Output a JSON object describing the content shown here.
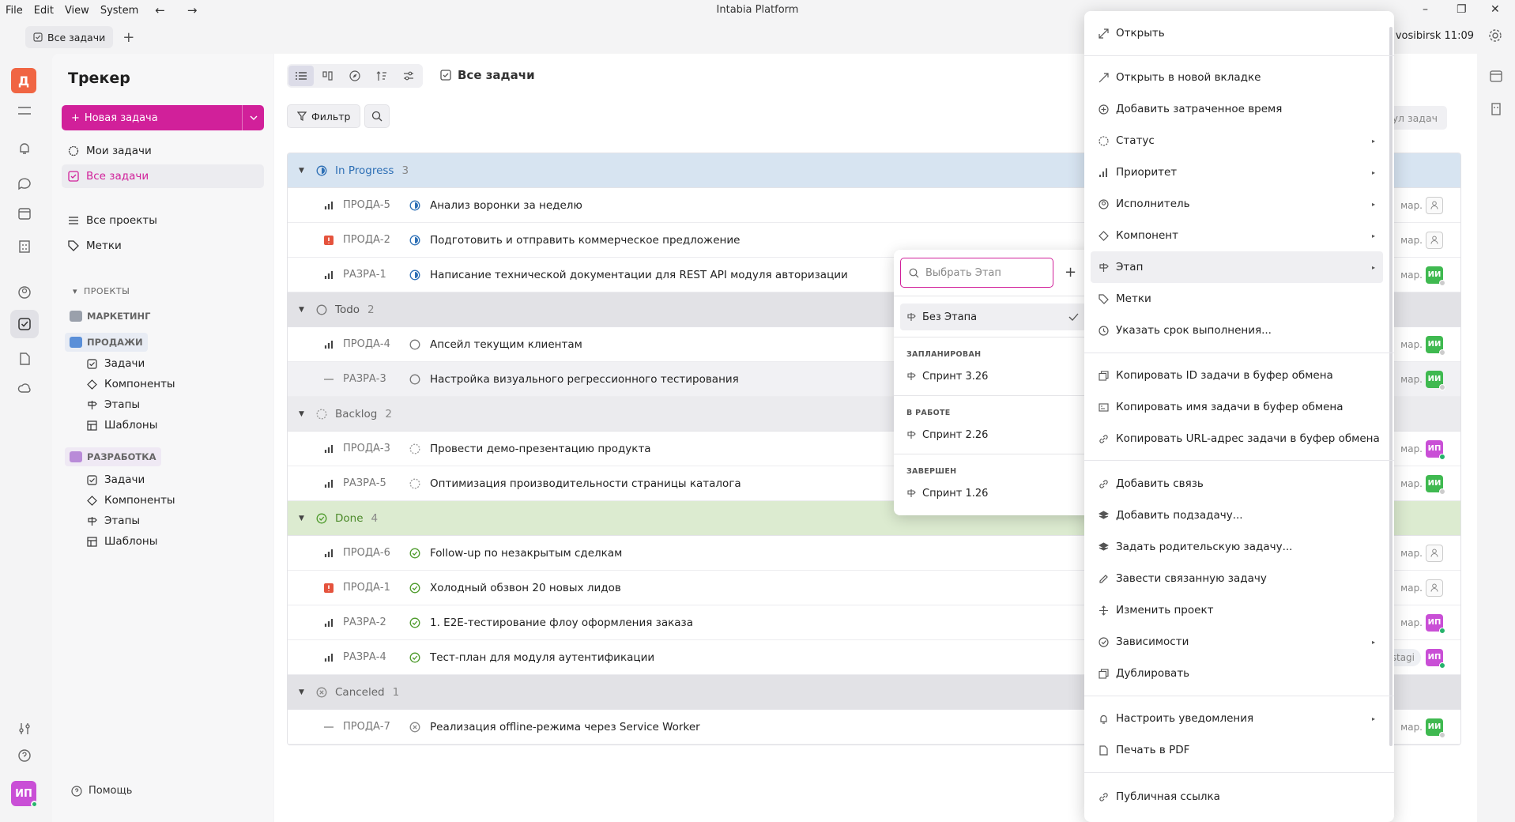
{
  "menubar": {
    "items": [
      "File",
      "Edit",
      "View",
      "System"
    ],
    "back": "←",
    "forward": "→",
    "app_title": "Intabia Platform",
    "win": {
      "min": "–",
      "max": "❐",
      "close": "✕"
    }
  },
  "tabs": [
    {
      "label": "Все задачи"
    }
  ],
  "tab_add": "+",
  "clock": "vosibirsk 11:09",
  "rail": {
    "avatar_top": "Д",
    "avatar_bottom": "ИП"
  },
  "sidebar": {
    "title": "Трекер",
    "new_task": "Новая задача",
    "my_tasks": "Мои задачи",
    "all_tasks": "Все задачи",
    "all_projects": "Все проекты",
    "labels": "Метки",
    "projects_header": "ПРОЕКТЫ",
    "projects": [
      {
        "name": "МАРКЕТИНГ",
        "color": "#9aa0ab"
      },
      {
        "name": "ПРОДАЖИ",
        "color": "#5a8fd8",
        "subs": [
          "Задачи",
          "Компоненты",
          "Этапы",
          "Шаблоны"
        ]
      },
      {
        "name": "РАЗРАБОТКА",
        "color": "#b98bd8",
        "subs": [
          "Задачи",
          "Компоненты",
          "Этапы",
          "Шаблоны"
        ]
      }
    ],
    "help": "Помощь"
  },
  "main": {
    "title": "Все задачи",
    "filter": "Фильтр",
    "pool": "Пул задач",
    "groups": [
      {
        "name": "In Progress",
        "count": "3",
        "bg": "#d7e4f1",
        "color": "#2d6fb5",
        "rows": [
          {
            "id": "ПРОДА-5",
            "name": "Анализ воронки за неделю",
            "pri": "bars",
            "tail": "мар.",
            "asg": "",
            "asg_color": ""
          },
          {
            "id": "ПРОДА-2",
            "name": "Подготовить и отправить коммерческое предложение",
            "pri": "urgent",
            "tail": "мар.",
            "asg": "",
            "asg_color": ""
          },
          {
            "id": "РАЗРА-1",
            "name": "Написание технической документации для REST API модуля авторизации",
            "pri": "bars",
            "tail": "мар.",
            "asg": "ИИ",
            "asg_color": "#3fb950"
          }
        ]
      },
      {
        "name": "Todo",
        "count": "2",
        "bg": "#e2e2e6",
        "color": "#555",
        "rows": [
          {
            "id": "ПРОДА-4",
            "name": "Апсейл текущим клиентам",
            "pri": "bars",
            "tail": "мар.",
            "asg": "ИИ",
            "asg_color": "#3fb950"
          },
          {
            "id": "РАЗРА-3",
            "name": "Настройка визуального регрессионного тестирования",
            "pri": "none",
            "tail": "мар.",
            "asg": "ИИ",
            "asg_color": "#3fb950"
          }
        ]
      },
      {
        "name": "Backlog",
        "count": "2",
        "bg": "#ebebee",
        "color": "#666",
        "rows": [
          {
            "id": "ПРОДА-3",
            "name": "Провести демо-презентацию продукта",
            "pri": "bars",
            "tail": "мар.",
            "asg": "ИП",
            "asg_color": "#c94fd6"
          },
          {
            "id": "РАЗРА-5",
            "name": "Оптимизация производительности страницы каталога",
            "pri": "bars",
            "tail": "мар.",
            "asg": "ИИ",
            "asg_color": "#3fb950"
          }
        ]
      },
      {
        "name": "Done",
        "count": "4",
        "bg": "#dcebd0",
        "color": "#4c8a2a",
        "rows": [
          {
            "id": "ПРОДА-6",
            "name": "Follow-up по незакрытым сделкам",
            "pri": "bars",
            "tail": "мар.",
            "asg": "",
            "asg_color": ""
          },
          {
            "id": "ПРОДА-1",
            "name": "Холодный обзвон 20 новых лидов",
            "pri": "urgent",
            "tail": "мар.",
            "asg": "",
            "asg_color": ""
          },
          {
            "id": "РАЗРА-2",
            "name": "1. E2E-тестирование флоу оформления заказа",
            "pri": "bars",
            "tail": "мар.",
            "asg": "ИП",
            "asg_color": "#c94fd6"
          },
          {
            "id": "РАЗРА-4",
            "name": "Тест-план для модуля аутентификации",
            "pri": "bars",
            "tail": "мар.",
            "asg": "ИП",
            "asg_color": "#c94fd6",
            "tag": "stagi"
          }
        ]
      },
      {
        "name": "Canceled",
        "count": "1",
        "bg": "#e2e2e6",
        "color": "#666",
        "rows": [
          {
            "id": "ПРОДА-7",
            "name": "Реализация offline-режима через Service Worker",
            "pri": "none",
            "tail": "мар.",
            "asg": "ИИ",
            "asg_color": "#3fb950"
          }
        ]
      }
    ]
  },
  "stage_popup": {
    "placeholder": "Выбрать Этап",
    "add": "+",
    "none_option": "Без Этапа",
    "categories": [
      {
        "name": "ЗАПЛАНИРОВАН",
        "item": "Спринт 3.26"
      },
      {
        "name": "В РАБОТЕ",
        "item": "Спринт 2.26"
      },
      {
        "name": "ЗАВЕРШЕН",
        "item": "Спринт 1.26"
      }
    ]
  },
  "context_menu": {
    "open": "Открыть",
    "open_tab": "Открыть в новой вкладке",
    "add_time": "Добавить затраченное время",
    "status": "Статус",
    "priority": "Приоритет",
    "assignee": "Исполнитель",
    "component": "Компонент",
    "stage": "Этап",
    "labels": "Метки",
    "due": "Указать срок выполнения...",
    "copy_id": "Копировать ID задачи в буфер обмена",
    "copy_name": "Копировать имя задачи в буфер обмена",
    "copy_url": "Копировать URL-адрес задачи в буфер обмена",
    "add_link": "Добавить связь",
    "add_subtask": "Добавить подзадачу...",
    "set_parent": "Задать родительскую задачу...",
    "related": "Завести связанную задачу",
    "move_project": "Изменить проект",
    "deps": "Зависимости",
    "duplicate": "Дублировать",
    "notifications": "Настроить уведомления",
    "print_pdf": "Печать в PDF",
    "public_link": "Публичная ссылка",
    "submenu_arrow": "▸"
  },
  "colors": {
    "accent": "#d1209a",
    "green": "#3fb950",
    "purple": "#c94fd6",
    "urgent": "#e5533d"
  }
}
